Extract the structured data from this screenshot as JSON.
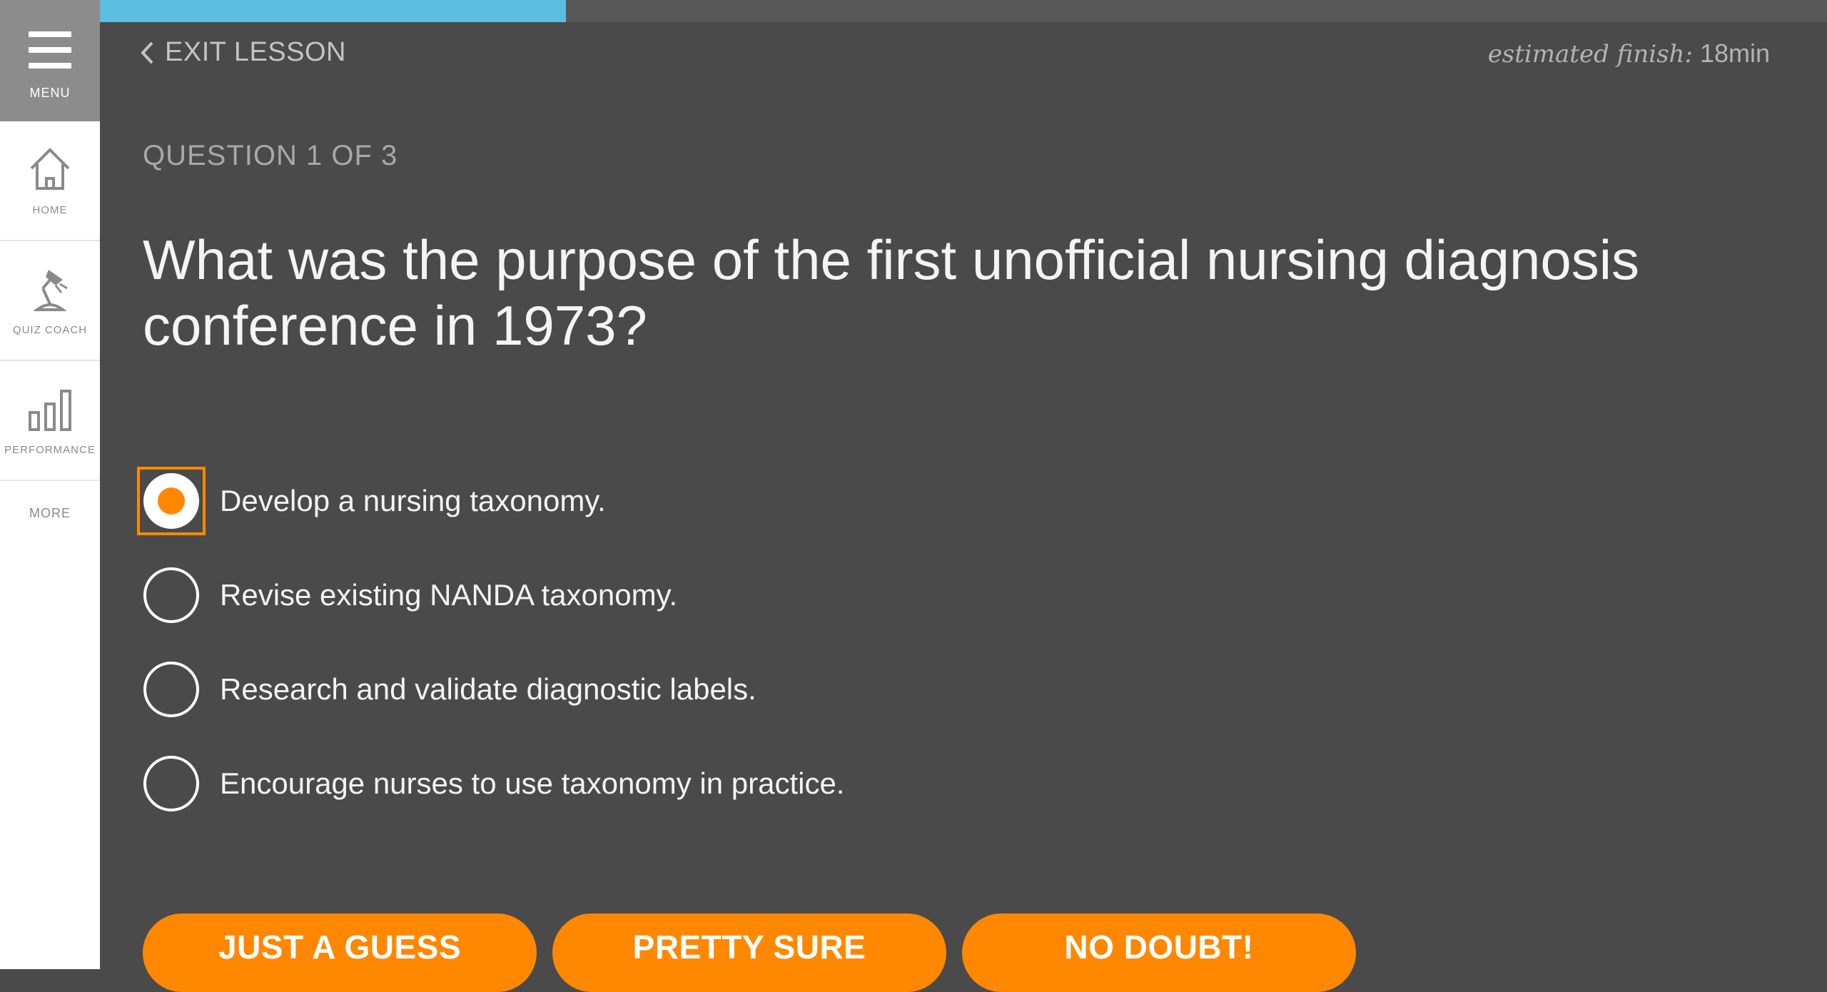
{
  "sidebar": {
    "menu_label": "MENU",
    "items": [
      {
        "label": "HOME",
        "icon": "home-icon"
      },
      {
        "label": "QUIZ COACH",
        "icon": "desk-lamp-icon"
      },
      {
        "label": "PERFORMANCE",
        "icon": "bar-chart-icon"
      }
    ],
    "more_label": "MORE"
  },
  "header": {
    "exit_label": "EXIT LESSON",
    "estimate_prefix": "estimated finish:",
    "estimate_value": "18min",
    "progress": 0.27
  },
  "question": {
    "counter": "QUESTION 1 OF 3",
    "text": "What was the purpose of the first unofficial nursing diagnosis conference in 1973?",
    "options": [
      {
        "label": "Develop a nursing taxonomy.",
        "selected": true
      },
      {
        "label": "Revise existing NANDA taxonomy.",
        "selected": false
      },
      {
        "label": "Research and validate diagnostic labels.",
        "selected": false
      },
      {
        "label": "Encourage nurses to use taxonomy in practice.",
        "selected": false
      }
    ]
  },
  "confidence_buttons": [
    "JUST A GUESS",
    "PRETTY SURE",
    "NO DOUBT!"
  ],
  "colors": {
    "accent": "#ff8800",
    "progress": "#5bbde0",
    "background": "#4a4a4a",
    "sidebar": "#ffffff",
    "menu": "#8c8c8c"
  }
}
